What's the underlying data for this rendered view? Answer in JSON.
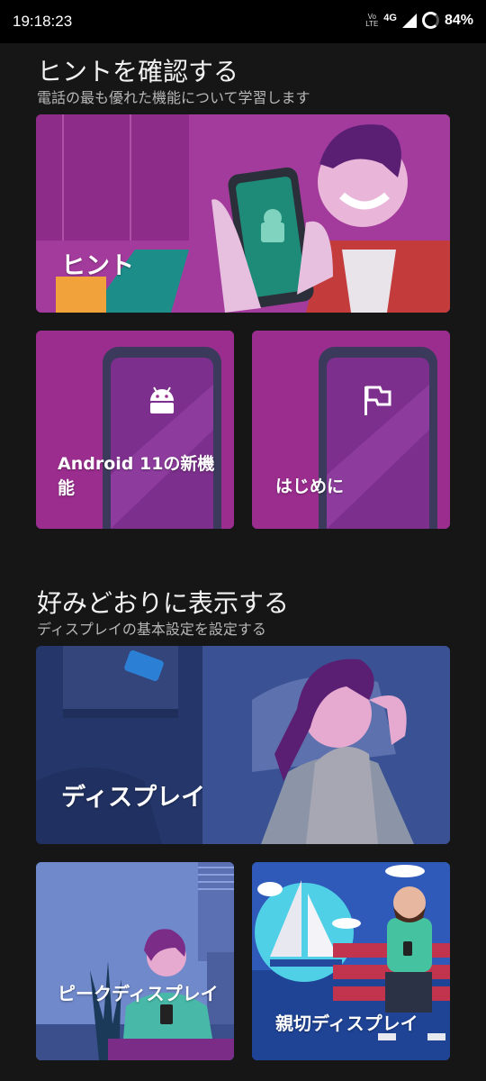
{
  "status_bar": {
    "time": "19:18:23",
    "volte_top": "Vo",
    "volte_bottom": "LTE",
    "network": "4G",
    "battery": "84%"
  },
  "sections": [
    {
      "title": "ヒントを確認する",
      "subtitle": "電話の最も優れた機能について学習します",
      "cards": [
        {
          "label": "ヒント"
        },
        {
          "label": "Android 11の新機能"
        },
        {
          "label": "はじめに"
        }
      ]
    },
    {
      "title": "好みどおりに表示する",
      "subtitle": "ディスプレイの基本設定を設定する",
      "cards": [
        {
          "label": "ディスプレイ"
        },
        {
          "label": "ピークディスプレイ"
        },
        {
          "label": "親切ディスプレイ"
        }
      ]
    }
  ],
  "colors": {
    "background": "#161616",
    "magenta_card": "#9b2d8f",
    "display_card": "#24366a",
    "peek_card": "#6f86c9",
    "attentive_card": "#2f57b8"
  },
  "icons": [
    "android-icon",
    "flag-icon",
    "signal-icon",
    "battery-icon"
  ]
}
